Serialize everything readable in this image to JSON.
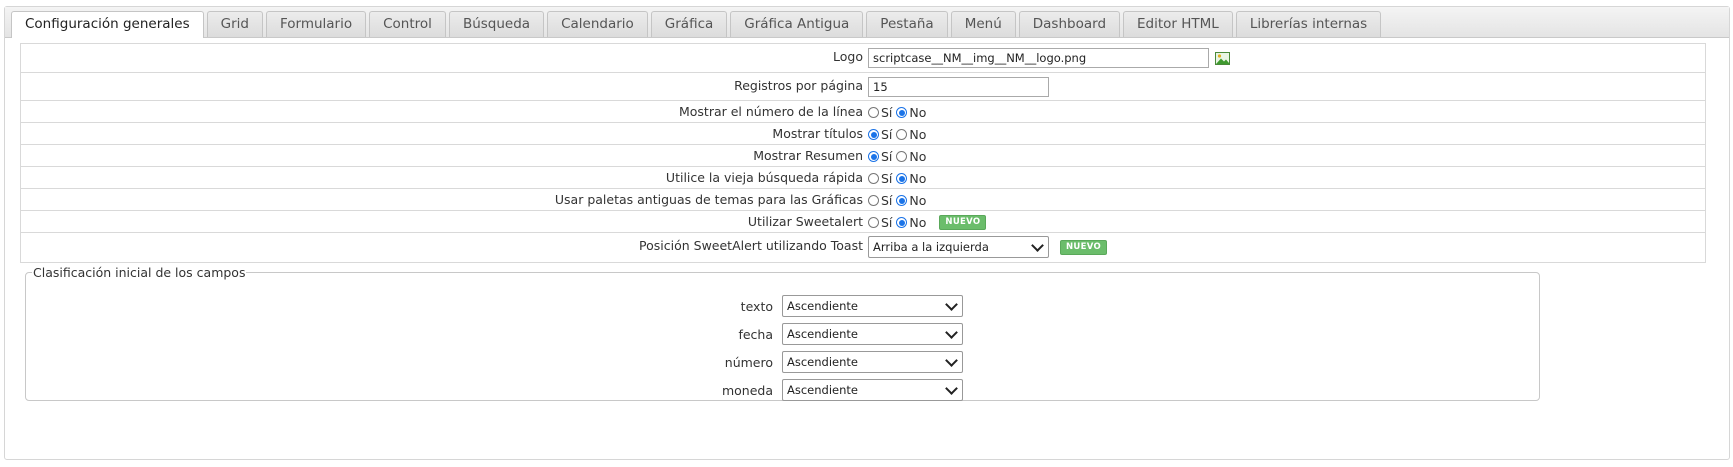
{
  "tabs": [
    "Configuración generales",
    "Grid",
    "Formulario",
    "Control",
    "Búsqueda",
    "Calendario",
    "Gráfica",
    "Gráfica Antigua",
    "Pestaña",
    "Menú",
    "Dashboard",
    "Editor HTML",
    "Librerías internas"
  ],
  "active_tab": 0,
  "form": {
    "logo": {
      "label": "Logo",
      "value": "scriptcase__NM__img__NM__logo.png"
    },
    "registros": {
      "label": "Registros por página",
      "value": "15"
    },
    "radios": [
      {
        "label": "Mostrar el número de la línea",
        "selected": "No"
      },
      {
        "label": "Mostrar títulos",
        "selected": "Sí"
      },
      {
        "label": "Mostrar Resumen",
        "selected": "Sí"
      },
      {
        "label": "Utilice la vieja búsqueda rápida",
        "selected": "No"
      },
      {
        "label": "Usar paletas antiguas de temas para las Gráficas",
        "selected": "No"
      },
      {
        "label": "Utilizar Sweetalert",
        "selected": "No",
        "badge": "NUEVO"
      }
    ],
    "yes_label": "Sí",
    "no_label": "No",
    "toast": {
      "label": "Posición SweetAlert utilizando Toast",
      "value": "Arriba a la izquierda",
      "badge": "NUEVO"
    }
  },
  "sorting": {
    "legend": "Clasificación inicial de los campos",
    "fields": [
      {
        "label": "texto",
        "value": "Ascendiente"
      },
      {
        "label": "fecha",
        "value": "Ascendiente"
      },
      {
        "label": "número",
        "value": "Ascendiente"
      },
      {
        "label": "moneda",
        "value": "Ascendiente"
      }
    ]
  },
  "colors": {
    "accent": "#1a73e8",
    "badge": "#6bbd6b"
  }
}
